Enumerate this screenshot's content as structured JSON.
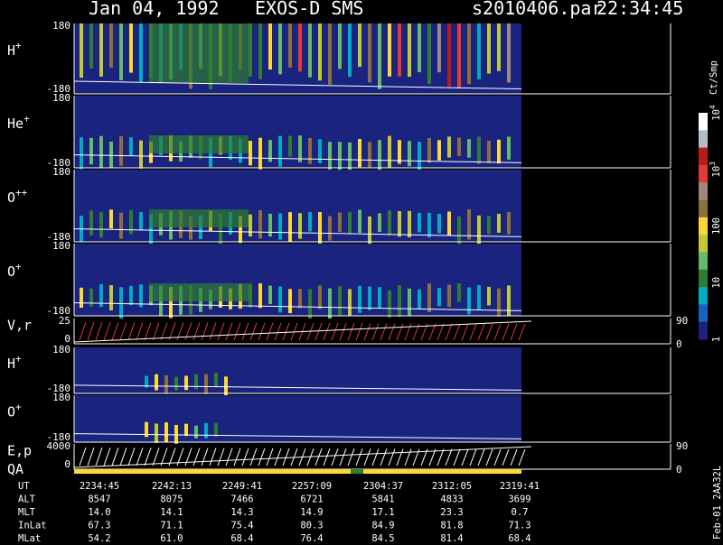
{
  "header": {
    "date": "Jan 04, 1992",
    "instrument": "EXOS-D SMS",
    "file": "s2010406.par",
    "time": "22:34:45"
  },
  "chart_data": {
    "type": "heatmap",
    "x_time_labels": [
      "2234:45",
      "2242:13",
      "2249:41",
      "2257:09",
      "2304:37",
      "2312:05",
      "2319:41"
    ],
    "panels": [
      {
        "name": "H",
        "superscript": "+",
        "top_tick": "180",
        "bottom_tick": "-180"
      },
      {
        "name": "He",
        "superscript": "+",
        "top_tick": "180",
        "bottom_tick": "-180"
      },
      {
        "name": "O",
        "superscript": "++",
        "top_tick": "180",
        "bottom_tick": "-180"
      },
      {
        "name": "O",
        "superscript": "+",
        "top_tick": "180",
        "bottom_tick": "-180"
      },
      {
        "name": "V,r",
        "superscript": "",
        "top_tick": "25",
        "bottom_tick": "0",
        "right_top": "90",
        "right_bottom": "0"
      },
      {
        "name": "H",
        "superscript": "+",
        "top_tick": "180",
        "bottom_tick": "-180"
      },
      {
        "name": "O",
        "superscript": "+",
        "top_tick": "180",
        "bottom_tick": "-180"
      },
      {
        "name": "E,p",
        "superscript": "",
        "top_tick": "4000",
        "bottom_tick": "0",
        "right_top": "90",
        "right_bottom": "0"
      }
    ],
    "qa_label": "QA",
    "colorbar": {
      "unit": "Ct/Smp",
      "labels": [
        {
          "text": "1",
          "pos": 1.0
        },
        {
          "text": "10",
          "pos": 0.75
        },
        {
          "text": "100",
          "pos": 0.5
        },
        {
          "text": "10",
          "sup": "3",
          "pos": 0.25
        },
        {
          "text": "10",
          "sup": "4",
          "pos": 0.0
        }
      ],
      "colors": [
        "#1a237e",
        "#1565c0",
        "#00acc1",
        "#2e7d32",
        "#66bb6a",
        "#c0ca33",
        "#fdd835",
        "#8d6e3f",
        "#a1887f",
        "#e53935",
        "#b71c1c",
        "#b0bec5",
        "#ffffff"
      ]
    }
  },
  "ephemeris": {
    "rows": [
      {
        "label": "UT",
        "values": [
          "2234:45",
          "2242:13",
          "2249:41",
          "2257:09",
          "2304:37",
          "2312:05",
          "2319:41"
        ]
      },
      {
        "label": "ALT",
        "values": [
          "8547",
          "8075",
          "7466",
          "6721",
          "5841",
          "4833",
          "3699"
        ]
      },
      {
        "label": "MLT",
        "values": [
          "14.0",
          "14.1",
          "14.3",
          "14.9",
          "17.1",
          "23.3",
          "0.7"
        ]
      },
      {
        "label": "InLat",
        "values": [
          "67.3",
          "71.1",
          "75.4",
          "80.3",
          "84.9",
          "81.8",
          "71.3"
        ]
      },
      {
        "label": "MLat",
        "values": [
          "54.2",
          "61.0",
          "68.4",
          "76.4",
          "84.5",
          "81.4",
          "68.4"
        ]
      }
    ]
  },
  "footer_vertical": "Feb-01 2AA32L",
  "colors": {
    "background": "#000000",
    "plot_bg": "#1a237e",
    "accent_red": "#e53935",
    "qa_yellow": "#fdd835"
  }
}
